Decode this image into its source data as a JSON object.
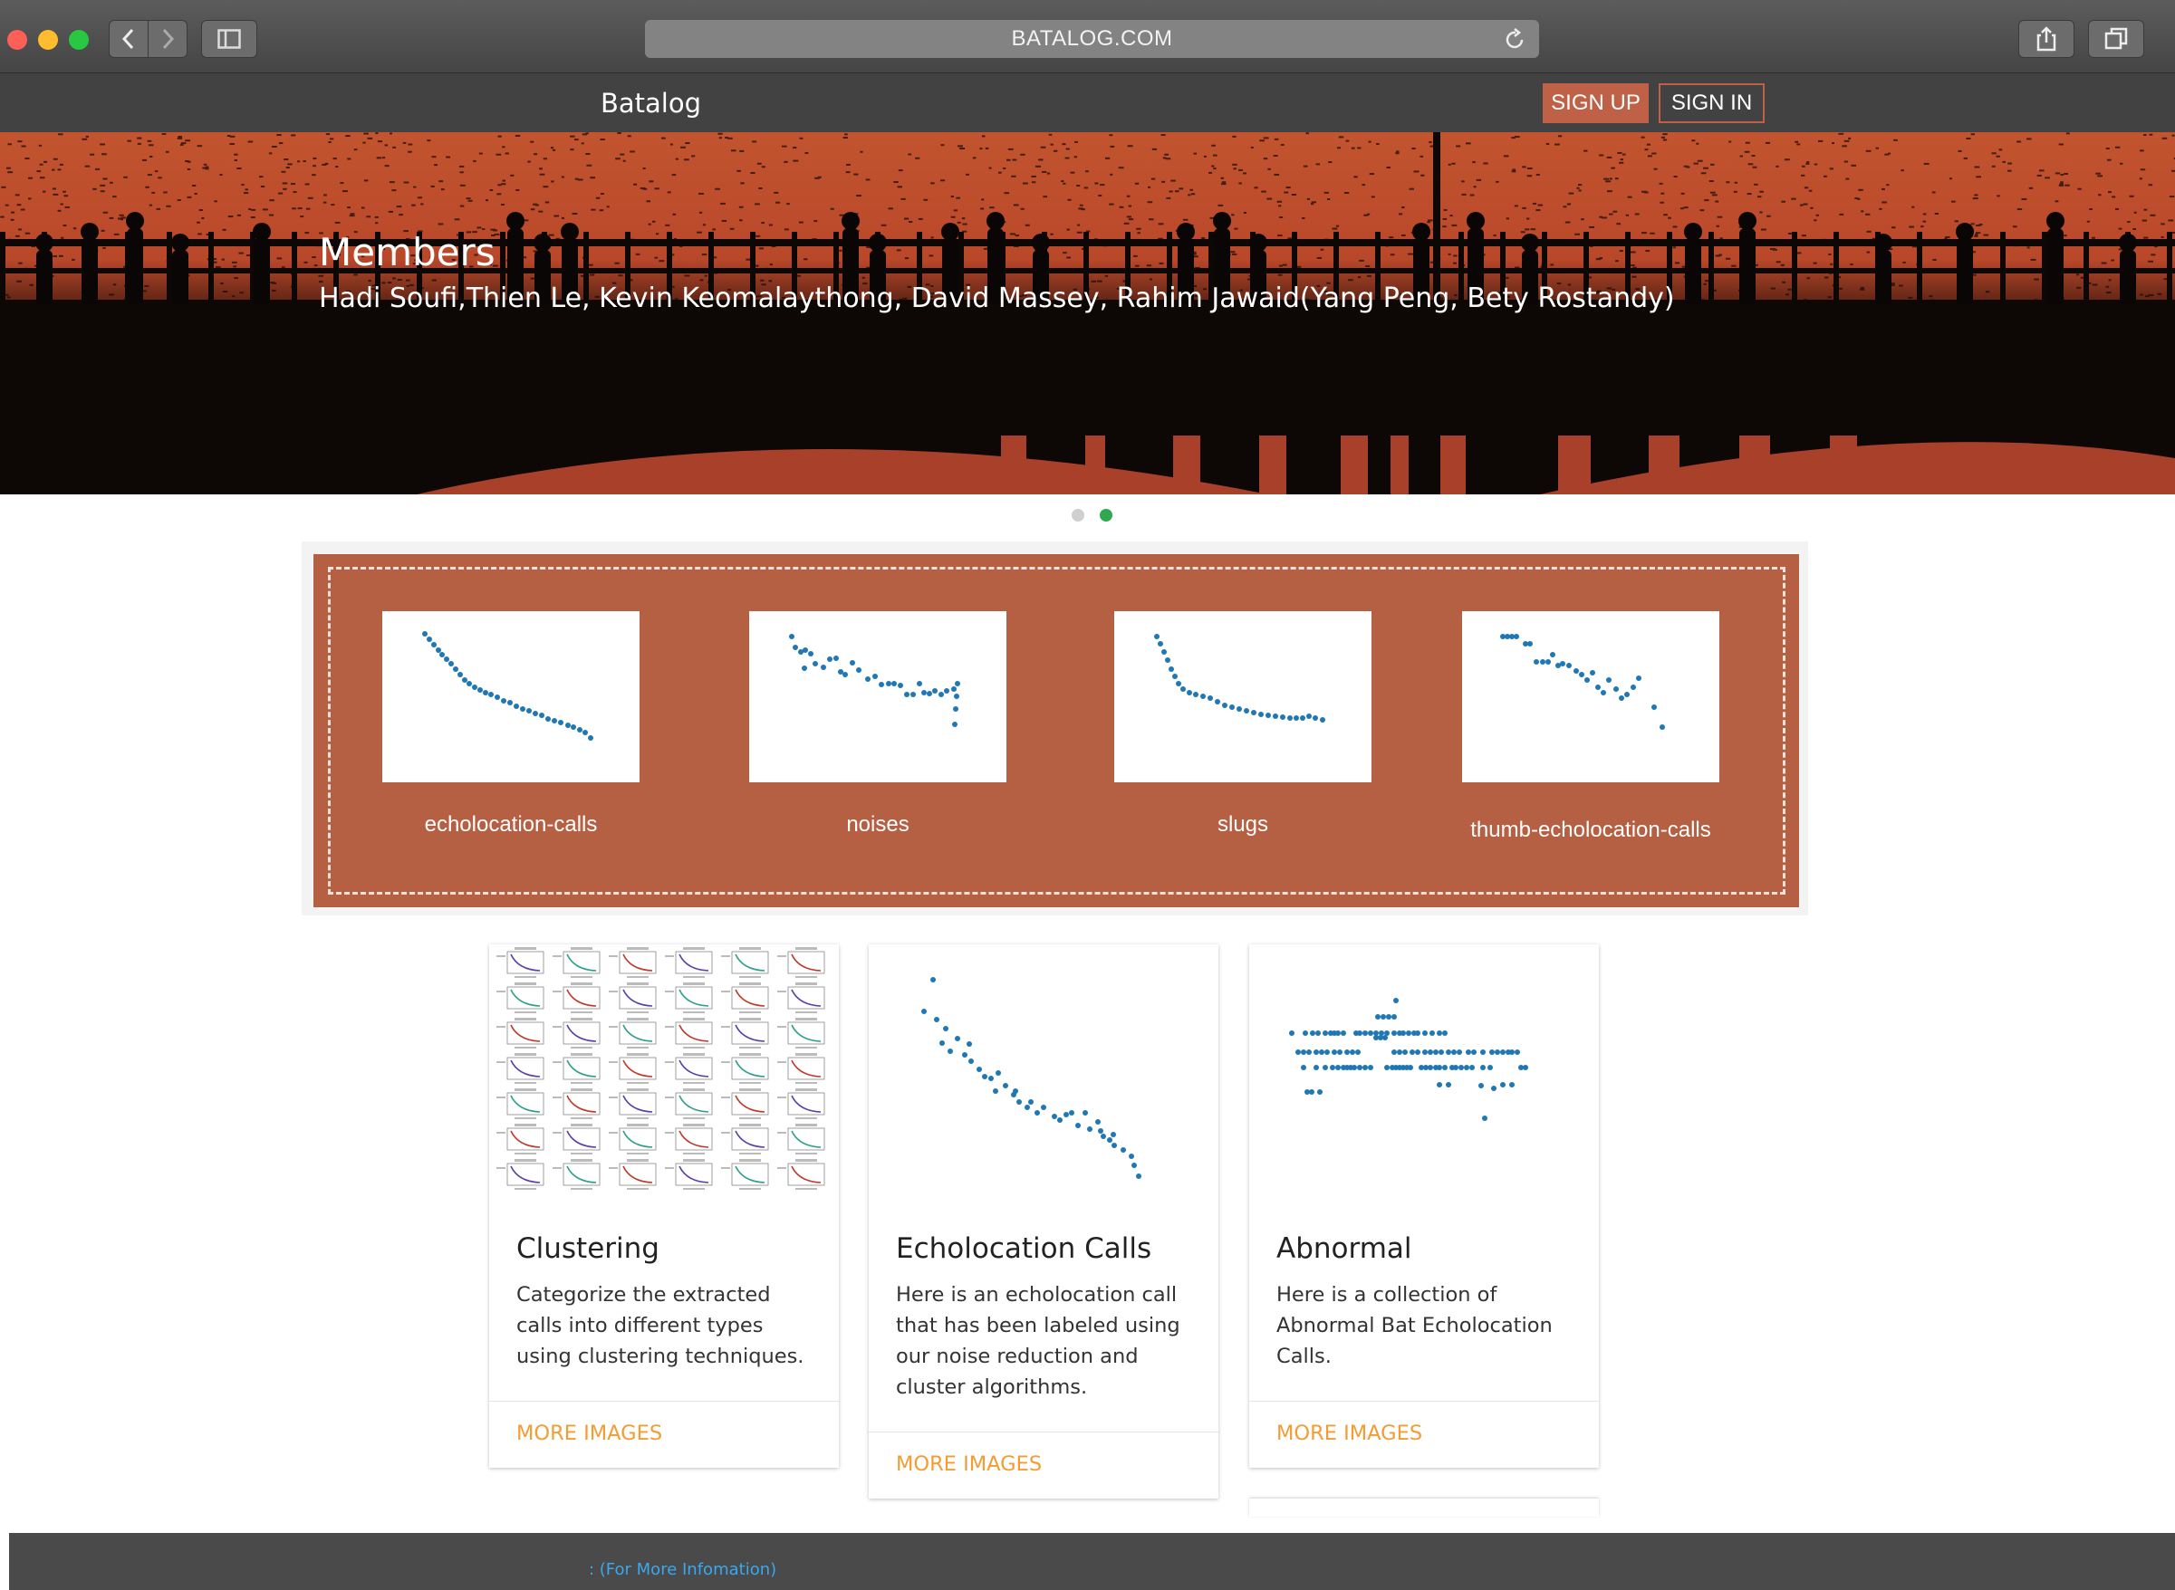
{
  "browser": {
    "url": "BATALOG.COM",
    "icons": [
      "chevron-left-icon",
      "chevron-right-icon",
      "sidebar-icon",
      "reload-icon",
      "share-icon",
      "tabs-icon"
    ]
  },
  "nav": {
    "brand": "Batalog",
    "signup_label": "SIGN UP",
    "signin_label": "SIGN IN",
    "accent_color": "#bf6146"
  },
  "hero": {
    "title": "Members",
    "subtitle": "Hadi Soufi,Thien Le, Kevin Keomalaythong, David Massey, Rahim Jawaid(Yang Peng, Bety Rostandy)",
    "carousel_active_index": 1,
    "carousel_count": 2
  },
  "categories": [
    {
      "label": "echolocation-calls"
    },
    {
      "label": "noises"
    },
    {
      "label": "slugs"
    },
    {
      "label": "thumb-echolocation-calls"
    }
  ],
  "cards": [
    {
      "title": "Clustering",
      "text": "Categorize the extracted calls into different types using clustering techniques.",
      "action": "MORE IMAGES"
    },
    {
      "title": "Echolocation Calls",
      "text": "Here is an echolocation call that has been labeled using our noise reduction and cluster algorithms.",
      "action": "MORE IMAGES"
    },
    {
      "title": "Abnormal",
      "text": "Here is a collection of Abnormal Bat Echolocation Calls.",
      "action": "MORE IMAGES"
    }
  ],
  "footer": {
    "link_label": ": (For More Infomation)"
  }
}
